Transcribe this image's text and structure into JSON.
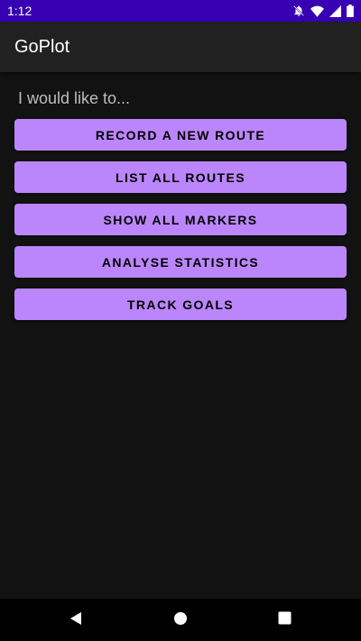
{
  "status_bar": {
    "time": "1:12",
    "icons": [
      "notifications-off-icon",
      "wifi-icon",
      "signal-icon",
      "battery-icon"
    ],
    "color": "#3700b3"
  },
  "app_bar": {
    "title": "GoPlot"
  },
  "main": {
    "prompt": "I would like to...",
    "buttons": [
      {
        "label": "RECORD A NEW ROUTE"
      },
      {
        "label": "LIST ALL ROUTES"
      },
      {
        "label": "SHOW ALL MARKERS"
      },
      {
        "label": "ANALYSE STATISTICS"
      },
      {
        "label": "TRACK GOALS"
      }
    ],
    "button_color": "#bb86fc"
  },
  "nav_bar": {
    "icons": [
      "back-icon",
      "home-icon",
      "recents-icon"
    ]
  }
}
